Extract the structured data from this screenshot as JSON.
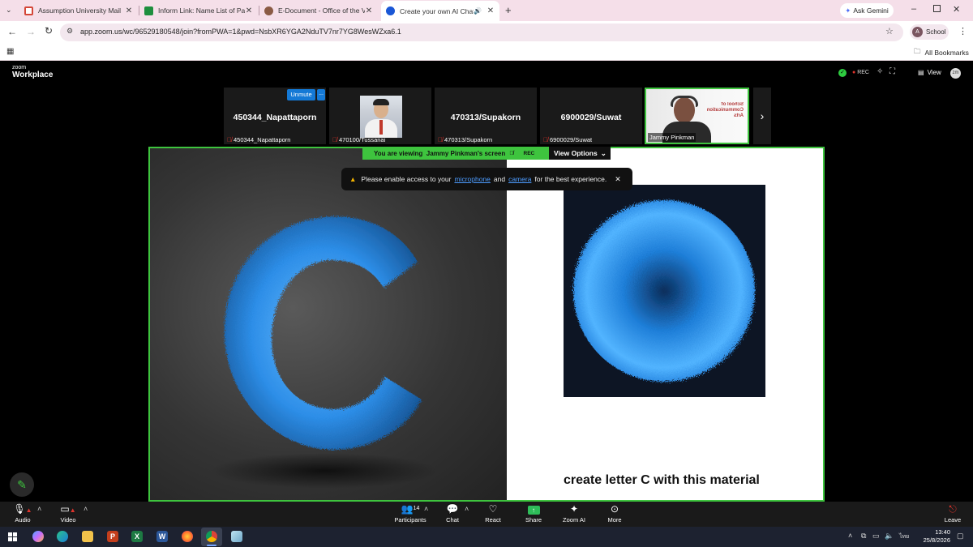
{
  "browser": {
    "tabs": [
      {
        "label": "Assumption University Mail",
        "color": "#d44638"
      },
      {
        "label": "Inform Link: Name List of Partic",
        "color": "#1e8e3e"
      },
      {
        "label": "E-Document - Office of the Vic",
        "color": "#8a5a44"
      },
      {
        "label": "Create your own AI Chatbo",
        "color": "#1a57d6",
        "active": true
      }
    ],
    "ask_gemini": "Ask Gemini",
    "url": "app.zoom.us/wc/96529180548/join?fromPWA=1&pwd=NsbXR6YGA2NduTV7nr7YG8WesWZxa6.1",
    "profile_initial": "A",
    "profile_label": "School",
    "all_bookmarks": "All Bookmarks"
  },
  "zoom": {
    "logo_top": "zoom",
    "logo_bottom": "Workplace",
    "rec_label": "REC",
    "view_label": "View",
    "avatar_initials": "zm",
    "participants_strip": [
      {
        "big_name": "450344_Napattaporn",
        "small_name": "450344_Napattaporn",
        "has_video": false
      },
      {
        "big_name": "",
        "small_name": "470100/Tussanai",
        "has_video": true
      },
      {
        "big_name": "470313/Supakorn",
        "small_name": "470313/Supakorn",
        "has_video": false
      },
      {
        "big_name": "6900029/Suwat",
        "small_name": "6900029/Suwat",
        "has_video": false
      },
      {
        "big_name": "",
        "small_name": "Jammy Pinkman",
        "has_video": true,
        "active_speaker": true
      }
    ],
    "unmute_label": "Unmute",
    "more_label": "...",
    "viewing_banner": "You are viewing  Jammy Pinkman's screen",
    "banner_rec": "REC",
    "view_options": "View Options",
    "notice": {
      "prefix": "Please enable access to your",
      "link1": "microphone",
      "mid": "and",
      "link2": "camera",
      "suffix": "for the best experience."
    },
    "shared_caption": "create letter C with this material",
    "controls": {
      "audio": "Audio",
      "video": "Video",
      "participants": "Participants",
      "participants_count": "14",
      "chat": "Chat",
      "react": "React",
      "share": "Share",
      "zoom_ai": "Zoom AI",
      "more": "More",
      "leave": "Leave"
    }
  },
  "taskbar": {
    "time": "13:40",
    "date": "25/8/2026",
    "lang": "ไทย"
  }
}
